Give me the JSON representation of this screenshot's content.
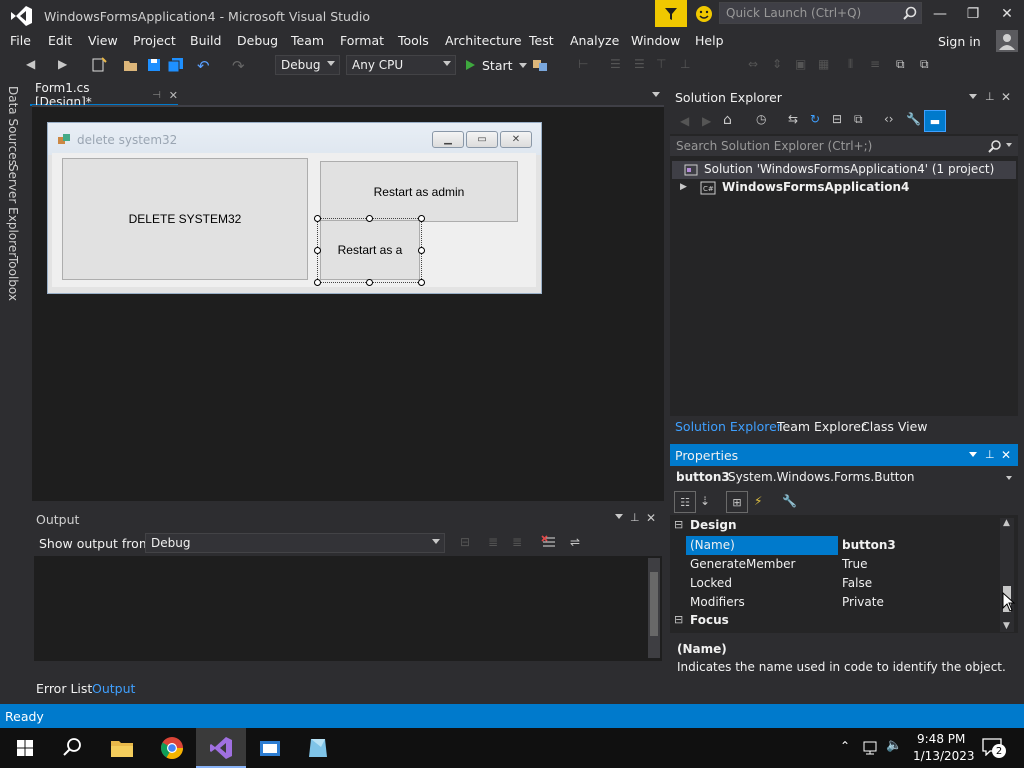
{
  "window": {
    "title": "WindowsFormsApplication4 - Microsoft Visual Studio",
    "quick_launch_placeholder": "Quick Launch (Ctrl+Q)",
    "minimize": "—",
    "restore": "❐",
    "close": "✕"
  },
  "menu": {
    "items": [
      "File",
      "Edit",
      "View",
      "Project",
      "Build",
      "Debug",
      "Team",
      "Format",
      "Tools",
      "Architecture",
      "Test",
      "Analyze",
      "Window",
      "Help"
    ],
    "sign_in": "Sign in"
  },
  "toolbar": {
    "config": "Debug",
    "platform": "Any CPU",
    "start": "Start"
  },
  "left_tabs": [
    "Data Sources",
    "Server Explorer",
    "Toolbox"
  ],
  "document": {
    "tab_label": "Form1.cs [Design]*",
    "form": {
      "title": "delete system32",
      "buttons": [
        {
          "label": "DELETE SYSTEM32"
        },
        {
          "label": "Restart as admin"
        },
        {
          "label": "Restart as a"
        }
      ]
    }
  },
  "output": {
    "title": "Output",
    "show_from_label": "Show output from:",
    "show_from_value": "Debug",
    "tabs": [
      "Error List",
      "Output"
    ]
  },
  "solution_explorer": {
    "title": "Solution Explorer",
    "search_placeholder": "Search Solution Explorer (Ctrl+;)",
    "solution": "Solution 'WindowsFormsApplication4' (1 project)",
    "project": "WindowsFormsApplication4",
    "tabs": [
      "Solution Explorer",
      "Team Explorer",
      "Class View"
    ]
  },
  "properties": {
    "title": "Properties",
    "object_name": "button3",
    "object_type": "System.Windows.Forms.Button",
    "categories": [
      "Design",
      "Focus"
    ],
    "rows": [
      {
        "name": "(Name)",
        "value": "button3"
      },
      {
        "name": "GenerateMember",
        "value": "True"
      },
      {
        "name": "Locked",
        "value": "False"
      },
      {
        "name": "Modifiers",
        "value": "Private"
      }
    ],
    "desc_title": "(Name)",
    "desc_text": "Indicates the name used in code to identify the object."
  },
  "status": {
    "text": "Ready"
  },
  "taskbar": {
    "time": "9:48 PM",
    "date": "1/13/2023",
    "notifications": "2"
  },
  "colors": {
    "accent": "#007acc",
    "background": "#2d2d30",
    "filter": "#f0c800"
  }
}
